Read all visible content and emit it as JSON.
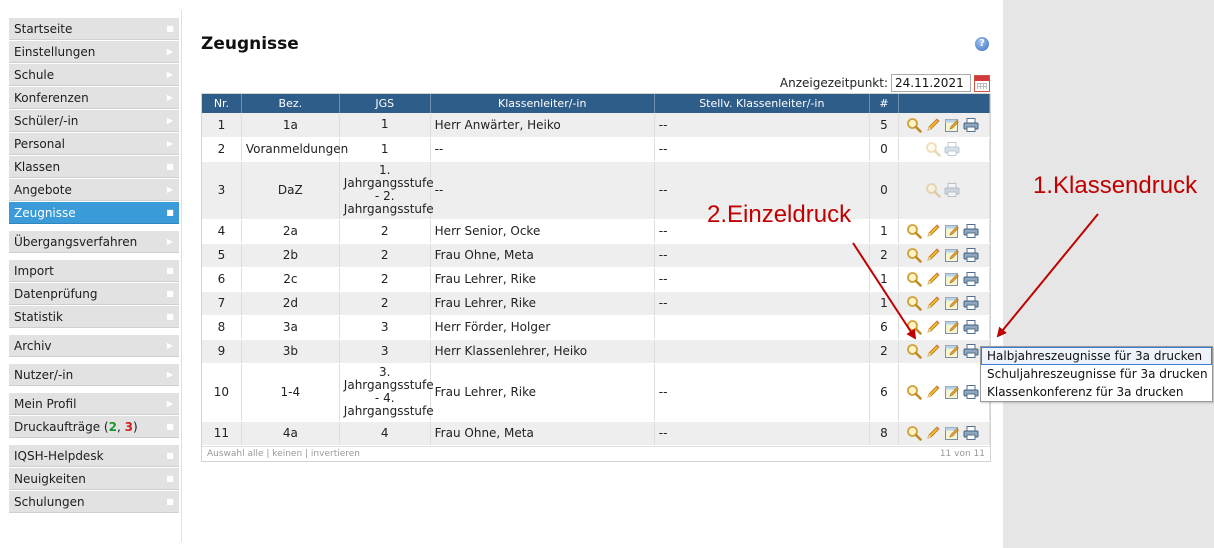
{
  "sidebar": {
    "groups": [
      {
        "items": [
          {
            "label": "Startseite",
            "marker": "square"
          },
          {
            "label": "Einstellungen",
            "marker": "arrow"
          },
          {
            "label": "Schule",
            "marker": "arrow"
          },
          {
            "label": "Konferenzen",
            "marker": "arrow"
          },
          {
            "label": "Schüler/-in",
            "marker": "arrow"
          },
          {
            "label": "Personal",
            "marker": "arrow"
          },
          {
            "label": "Klassen",
            "marker": "square"
          },
          {
            "label": "Angebote",
            "marker": "arrow"
          },
          {
            "label": "Zeugnisse",
            "marker": "square",
            "active": true
          }
        ]
      },
      {
        "items": [
          {
            "label": "Übergangsverfahren",
            "marker": "arrow"
          }
        ]
      },
      {
        "items": [
          {
            "label": "Import",
            "marker": "square"
          },
          {
            "label": "Datenprüfung",
            "marker": "square"
          },
          {
            "label": "Statistik",
            "marker": "square"
          }
        ]
      },
      {
        "items": [
          {
            "label": "Archiv",
            "marker": "arrow"
          }
        ]
      },
      {
        "items": [
          {
            "label": "Nutzer/-in",
            "marker": "arrow"
          }
        ]
      },
      {
        "items": [
          {
            "label": "Mein Profil",
            "marker": "arrow"
          },
          {
            "label": "Druckaufträge",
            "marker": "square",
            "count_green": "2",
            "count_red": "3"
          }
        ]
      },
      {
        "items": [
          {
            "label": "IQSH-Helpdesk",
            "marker": "square"
          },
          {
            "label": "Neuigkeiten",
            "marker": "square"
          },
          {
            "label": "Schulungen",
            "marker": "square"
          }
        ]
      }
    ]
  },
  "main": {
    "title": "Zeugnisse",
    "date_label": "Anzeigezeitpunkt:",
    "date_value": "24.11.2021",
    "table": {
      "headers": [
        "Nr.",
        "Bez.",
        "JGS",
        "Klassenleiter/-in",
        "Stellv. Klassenleiter/-in",
        "#",
        ""
      ],
      "rows": [
        {
          "nr": "1",
          "bez": "1a",
          "jgs": [
            "1"
          ],
          "kl": "Herr Anwärter, Heiko",
          "stv": "--",
          "count": "5",
          "actions": "full"
        },
        {
          "nr": "2",
          "bez": "Voranmeldungen",
          "jgs": [
            "1"
          ],
          "kl": "--",
          "stv": "--",
          "count": "0",
          "actions": "disabled"
        },
        {
          "nr": "3",
          "bez": "DaZ",
          "jgs": [
            "1.",
            "Jahrgangsstufe",
            "- 2.",
            "Jahrgangsstufe"
          ],
          "kl": "--",
          "stv": "--",
          "count": "0",
          "actions": "disabled"
        },
        {
          "nr": "4",
          "bez": "2a",
          "jgs": [
            "2"
          ],
          "kl": "Herr Senior, Ocke",
          "stv": "--",
          "count": "1",
          "actions": "full"
        },
        {
          "nr": "5",
          "bez": "2b",
          "jgs": [
            "2"
          ],
          "kl": "Frau Ohne, Meta",
          "stv": "--",
          "count": "2",
          "actions": "full"
        },
        {
          "nr": "6",
          "bez": "2c",
          "jgs": [
            "2"
          ],
          "kl": "Frau Lehrer, Rike",
          "stv": "--",
          "count": "1",
          "actions": "full"
        },
        {
          "nr": "7",
          "bez": "2d",
          "jgs": [
            "2"
          ],
          "kl": "Frau Lehrer, Rike",
          "stv": "--",
          "count": "1",
          "actions": "full"
        },
        {
          "nr": "8",
          "bez": "3a",
          "jgs": [
            "3"
          ],
          "kl": "Herr Förder, Holger",
          "stv": "",
          "count": "6",
          "actions": "full"
        },
        {
          "nr": "9",
          "bez": "3b",
          "jgs": [
            "3"
          ],
          "kl": "Herr Klassenlehrer, Heiko",
          "stv": "",
          "count": "2",
          "actions": "full"
        },
        {
          "nr": "10",
          "bez": "1-4",
          "jgs": [
            "3.",
            "Jahrgangsstufe",
            "- 4.",
            "Jahrgangsstufe"
          ],
          "kl": "Frau Lehrer, Rike",
          "stv": "--",
          "count": "6",
          "actions": "full"
        },
        {
          "nr": "11",
          "bez": "4a",
          "jgs": [
            "4"
          ],
          "kl": "Frau Ohne, Meta",
          "stv": "--",
          "count": "8",
          "actions": "full"
        }
      ],
      "footer_select": "Auswahl alle | keinen | invertieren",
      "footer_count": "11 von 11"
    },
    "print_menu": [
      "Halbjahreszeugnisse für 3a drucken",
      "Schuljahreszeugnisse für 3a drucken",
      "Klassenkonferenz für 3a drucken"
    ]
  },
  "annotations": {
    "einzeldruck": "2.Einzeldruck",
    "klassendruck": "1.Klassendruck",
    "color": "#c00000"
  },
  "colors": {
    "header": "#2f5d8a",
    "active_nav": "#3a9bd8",
    "nav_bg": "#e2e2e2"
  }
}
